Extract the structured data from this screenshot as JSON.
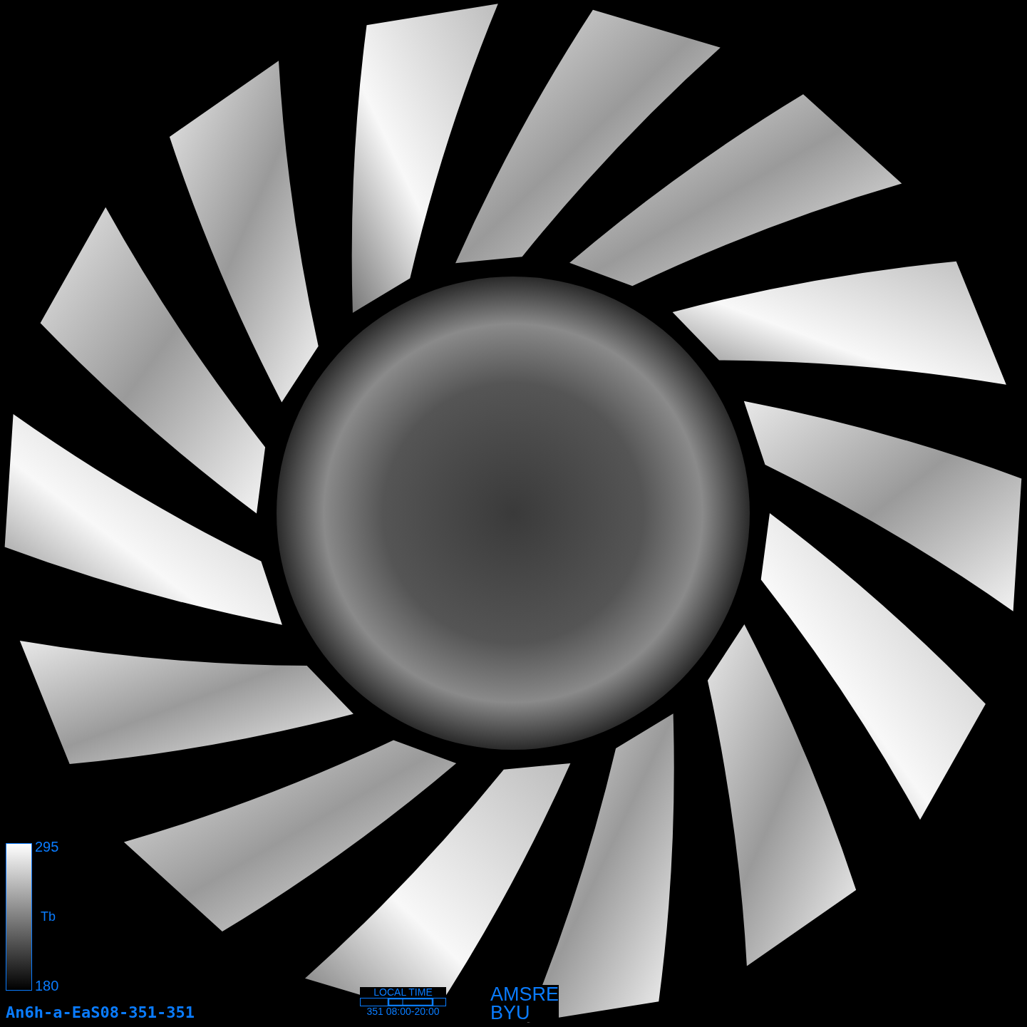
{
  "legend": {
    "max": "295",
    "label": "Tb",
    "min": "180"
  },
  "product_id": "An6h-a-EaS08-351-351",
  "local_time": {
    "title": "LOCAL TIME",
    "range": "351 08:00-20:00"
  },
  "credit": [
    "AMSRE",
    "BYU"
  ]
}
